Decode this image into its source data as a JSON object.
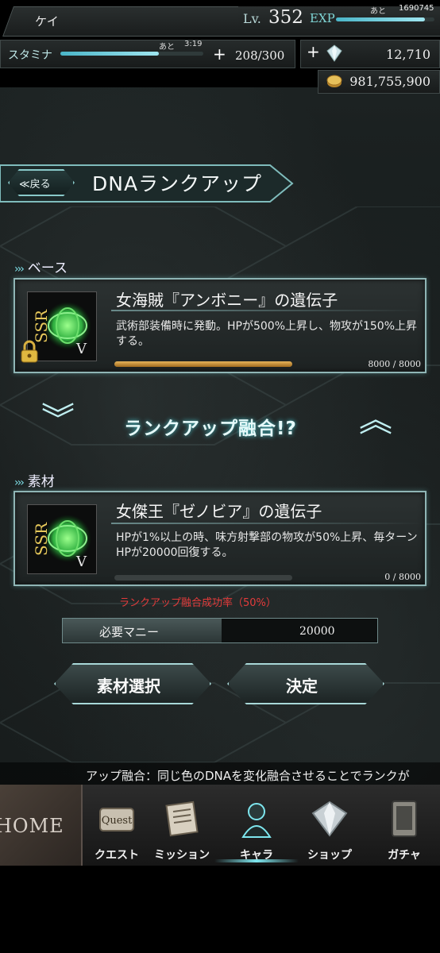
{
  "player": {
    "name": "ケイ",
    "lv_label": "Lv.",
    "level": "352",
    "exp_label": "EXP",
    "exp_remaining_label": "あと",
    "exp_remaining": "1690745",
    "exp_progress": 0.9
  },
  "stamina": {
    "label": "スタミナ",
    "timer_label": "あと",
    "timer": "3:19",
    "value": "208/300",
    "progress": 0.69
  },
  "currency": {
    "gems": "12,710",
    "money": "981,755,900"
  },
  "header": {
    "back_label": "≪戻る",
    "title": "DNAランクアップ"
  },
  "base": {
    "section_label": "ベース",
    "rarity": "SSR",
    "rank": "V",
    "name": "女海賊『アンボニー』の遺伝子",
    "description": "武術部装備時に発動。HPが500%上昇し、物攻が150%上昇する。",
    "exp": "8000 / 8000",
    "progress": 1.0,
    "locked": true
  },
  "fusion": {
    "label": "ランクアップ融合!?"
  },
  "material": {
    "section_label": "素材",
    "rarity": "SSR",
    "rank": "V",
    "name": "女傑王『ゼノビア』の遺伝子",
    "description": "HPが1%以上の時、味方射撃部の物攻が50%上昇、毎ターンHPが20000回復する。",
    "exp": "0 / 8000",
    "progress": 0.0
  },
  "success_rate": "ランクアップ融合成功率（50%）",
  "cost": {
    "label": "必要マニー",
    "value": "20000"
  },
  "buttons": {
    "select_material": "素材選択",
    "confirm": "決定"
  },
  "ticker": "アップ融合：同じ色のDNAを変化融合させることでランクが",
  "nav": {
    "home": "HOME",
    "items": [
      {
        "label": "クエスト",
        "icon": "quest-icon"
      },
      {
        "label": "ミッション",
        "icon": "mission-icon"
      },
      {
        "label": "キャラ",
        "icon": "character-icon"
      },
      {
        "label": "ショップ",
        "icon": "shop-icon"
      },
      {
        "label": "ガチャ",
        "icon": "gacha-icon"
      }
    ],
    "active": "キャラ"
  },
  "colors": {
    "accent": "#7fe0e8",
    "gold": "#e6b35a",
    "warning": "#e43b3b"
  }
}
